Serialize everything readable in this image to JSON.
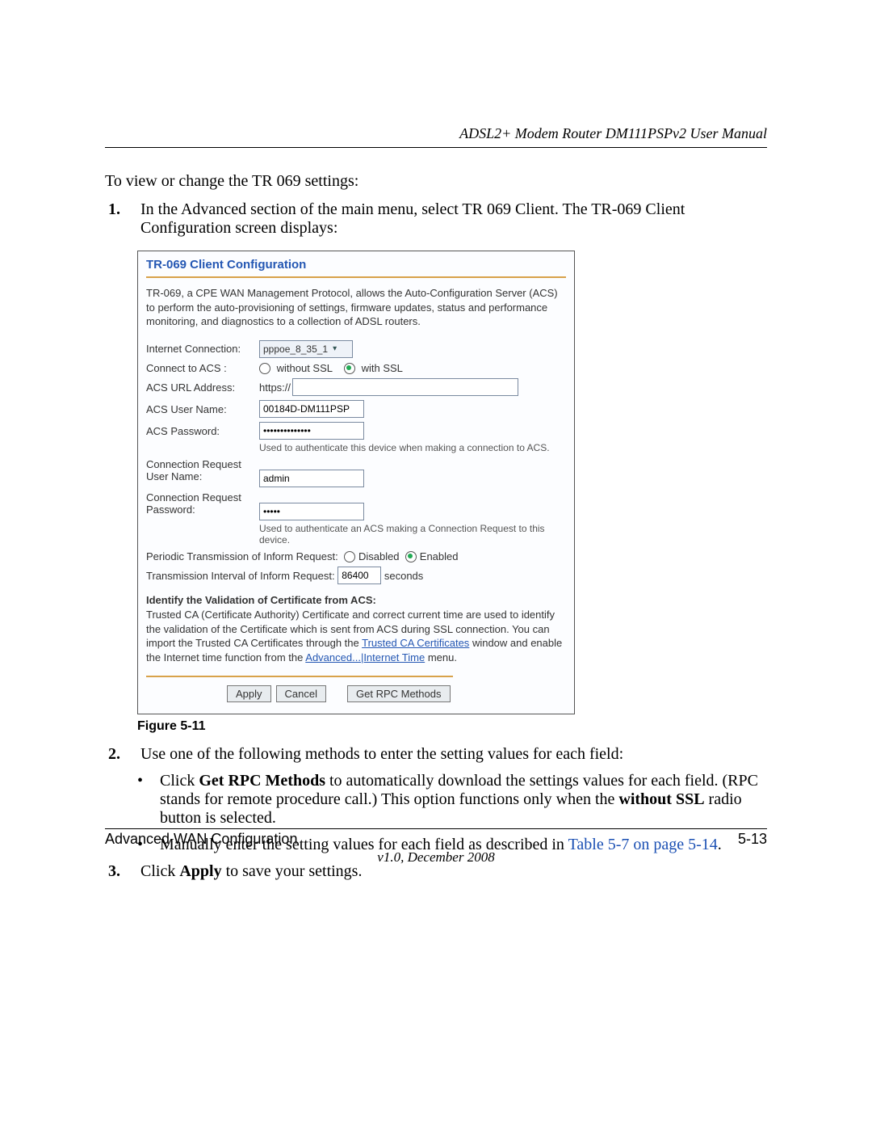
{
  "header": {
    "title": "ADSL2+ Modem Router DM111PSPv2 User Manual"
  },
  "intro": "To view or change the TR 069 settings:",
  "steps": {
    "s1": {
      "num": "1.",
      "text": "In the Advanced section of the main menu, select TR 069 Client. The TR-069 Client Configuration screen displays:"
    },
    "s2": {
      "num": "2.",
      "text": "Use one of the following methods to enter the setting values for each field:",
      "b1": {
        "pre": "Click ",
        "bold": "Get RPC Methods",
        "mid": " to automatically download the settings values for each field. (RPC stands for remote procedure call.) This option functions only when the ",
        "bold2": "without SSL",
        "post": " radio button is selected."
      },
      "b2": {
        "pre": "Manually enter the setting values for each field as described in ",
        "link": "Table 5-7 on page 5-14",
        "post": "."
      }
    },
    "s3": {
      "num": "3.",
      "pre": "Click ",
      "bold": "Apply",
      "post": " to save your settings."
    }
  },
  "figure": {
    "caption": "Figure 5-11",
    "title": "TR-069 Client Configuration",
    "desc": "TR-069, a CPE WAN Management Protocol, allows the Auto-Configuration Server (ACS) to perform the auto-provisioning of settings, firmware updates, status and performance monitoring, and diagnostics to a collection of ADSL routers.",
    "labels": {
      "internet_connection": "Internet Connection:",
      "connect_to_acs": "Connect to ACS :",
      "acs_url": "ACS URL Address:",
      "acs_user": "ACS User Name:",
      "acs_pass": "ACS Password:",
      "conn_req_user_line1": "Connection Request",
      "conn_req_user_line2": "User Name:",
      "conn_req_pass_line1": "Connection Request",
      "conn_req_pass_line2": "Password:"
    },
    "values": {
      "internet_connection": "pppoe_8_35_1",
      "without_ssl": "without SSL",
      "with_ssl": "with SSL",
      "acs_url_prefix": "https://",
      "acs_url_value": "",
      "acs_user": "00184D-DM111PSP",
      "acs_pass": "••••••••••••••",
      "conn_user": "admin",
      "conn_pass": "•••••"
    },
    "help": {
      "acs_pass": "Used to authenticate this device when making a connection to ACS.",
      "conn_pass": "Used to authenticate an ACS making a Connection Request to this device."
    },
    "inform": {
      "label_pre": "Periodic Transmission of Inform Request:",
      "disabled": "Disabled",
      "enabled": "Enabled",
      "interval_label": "Transmission Interval of Inform Request:",
      "interval_value": "86400",
      "interval_unit": "seconds"
    },
    "cert": {
      "heading": "Identify the Validation of Certificate from ACS:",
      "line1": "Trusted CA (Certificate Authority) Certificate and correct current time are used to identify the validation of the Certificate which is sent from ACS during SSL connection. You can import the Trusted CA Certificates through the ",
      "link1": "Trusted CA Certificates",
      "mid": " window and enable the Internet time function from the ",
      "link2": "Advanced...|Internet Time",
      "post": " menu."
    },
    "buttons": {
      "apply": "Apply",
      "cancel": "Cancel",
      "get_rpc": "Get RPC Methods"
    }
  },
  "footer": {
    "left": "Advanced WAN Configuration",
    "right": "5-13",
    "version": "v1.0, December 2008"
  }
}
